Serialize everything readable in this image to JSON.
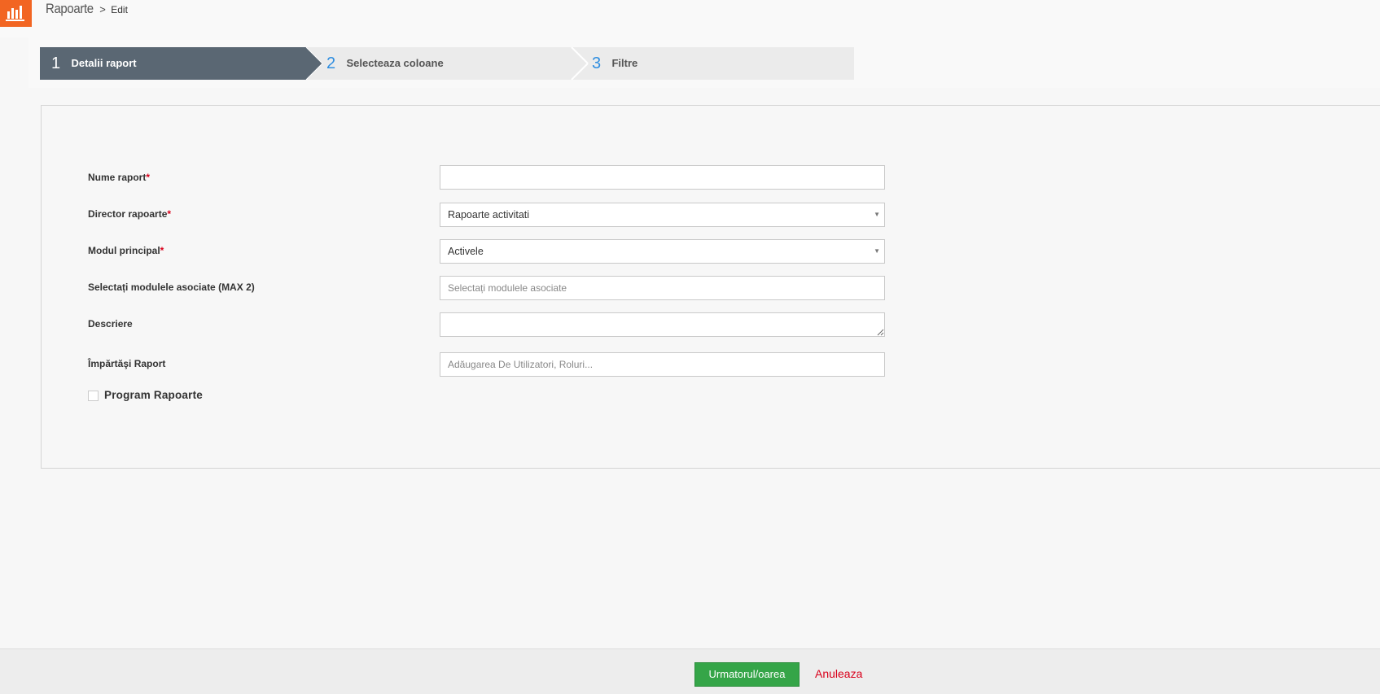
{
  "colors": {
    "brand_orange": "#f26522",
    "active_step": "#5a6773",
    "inactive_step": "#ebebeb",
    "step_number_blue": "#2f8ee0",
    "required_red": "#d9001b",
    "primary_green": "#35a548"
  },
  "header": {
    "app_icon": "bar-chart-icon",
    "breadcrumb_module": "Rapoarte",
    "breadcrumb_separator": ">",
    "breadcrumb_current": "Edit"
  },
  "steps": [
    {
      "number": "1",
      "label": "Detalii raport",
      "active": true
    },
    {
      "number": "2",
      "label": "Selecteaza coloane",
      "active": false
    },
    {
      "number": "3",
      "label": "Filtre",
      "active": false
    }
  ],
  "form": {
    "required_marker": "*",
    "report_name": {
      "label": "Nume raport",
      "value": "",
      "required": true
    },
    "report_folder": {
      "label": "Director rapoarte",
      "value": "Rapoarte activitati",
      "required": true
    },
    "primary_module": {
      "label": "Modul principal",
      "value": "Activele",
      "required": true
    },
    "related_modules": {
      "label": "Selectați modulele asociate (MAX 2)",
      "placeholder": "Selectați modulele asociate"
    },
    "description": {
      "label": "Descriere",
      "value": ""
    },
    "share_report": {
      "label": "Împărtăşi Raport",
      "placeholder": "Adăugarea De Utilizatori, Roluri..."
    },
    "schedule": {
      "label": "Program Rapoarte",
      "checked": false
    }
  },
  "footer": {
    "next_label": "Urmatorul/oarea",
    "cancel_label": "Anuleaza"
  }
}
